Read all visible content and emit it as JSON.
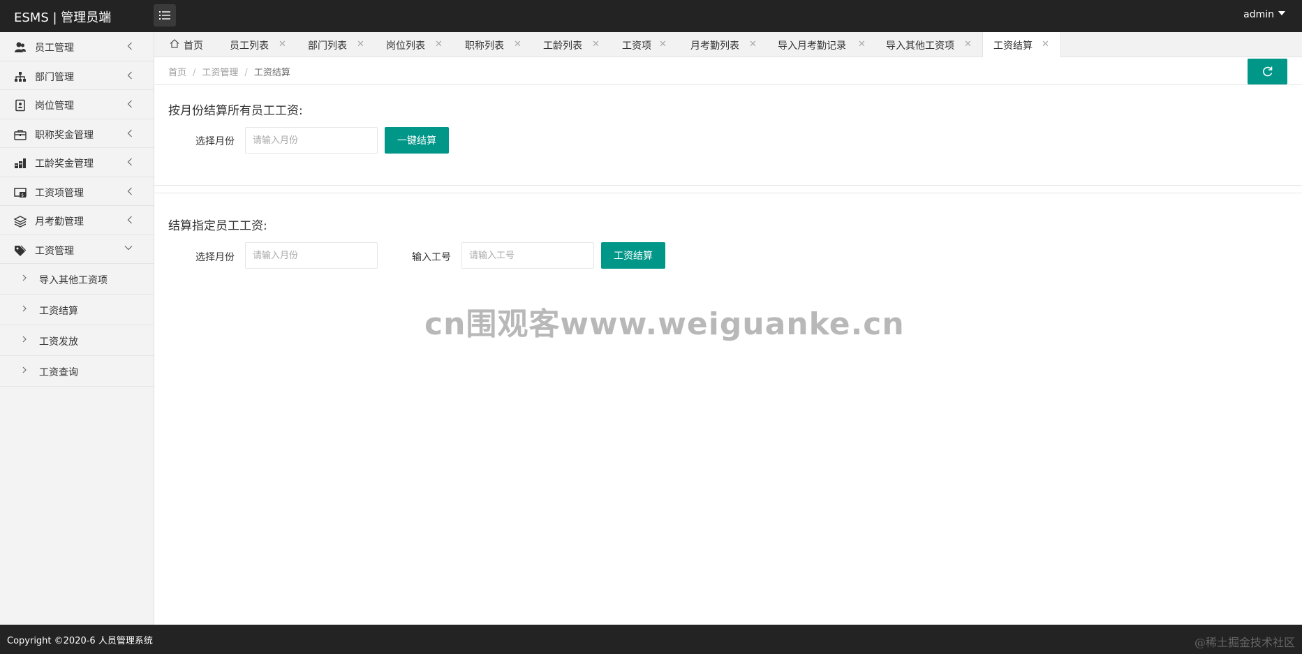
{
  "header": {
    "brand": "ESMS | 管理员端",
    "user": "admin"
  },
  "sidebar": {
    "items": [
      {
        "label": "员工管理",
        "icon": "users-icon"
      },
      {
        "label": "部门管理",
        "icon": "org-chart-icon"
      },
      {
        "label": "岗位管理",
        "icon": "badge-icon"
      },
      {
        "label": "职称奖金管理",
        "icon": "briefcase-icon"
      },
      {
        "label": "工龄奖金管理",
        "icon": "bars-icon"
      },
      {
        "label": "工资项管理",
        "icon": "money-card-icon"
      },
      {
        "label": "月考勤管理",
        "icon": "layers-icon"
      },
      {
        "label": "工资管理",
        "icon": "tag-icon"
      }
    ],
    "sub_items": [
      {
        "label": "导入其他工资项"
      },
      {
        "label": "工资结算"
      },
      {
        "label": "工资发放"
      },
      {
        "label": "工资查询"
      }
    ]
  },
  "tabs": [
    {
      "label": "首页"
    },
    {
      "label": "员工列表"
    },
    {
      "label": "部门列表"
    },
    {
      "label": "岗位列表"
    },
    {
      "label": "职称列表"
    },
    {
      "label": "工龄列表"
    },
    {
      "label": "工资项"
    },
    {
      "label": "月考勤列表"
    },
    {
      "label": "导入月考勤记录"
    },
    {
      "label": "导入其他工资项"
    },
    {
      "label": "工资结算"
    }
  ],
  "tab_close": "✕",
  "breadcrumb": {
    "items": [
      "首页",
      "工资管理",
      "工资结算"
    ],
    "separator": "/"
  },
  "section1": {
    "title": "按月份结算所有员工工资:",
    "month_label": "选择月份",
    "month_placeholder": "请输入月份",
    "button": "一键结算"
  },
  "section2": {
    "title": "结算指定员工工资:",
    "month_label": "选择月份",
    "month_placeholder": "请输入月份",
    "id_label": "输入工号",
    "id_placeholder": "请输入工号",
    "button": "工资结算"
  },
  "watermark": "cn围观客www.weiguanke.cn",
  "footer": {
    "copyright": "Copyright ©2020-6 人员管理系统",
    "juejin": "@稀土掘金技术社区"
  },
  "colors": {
    "accent": "#009688",
    "header_bg": "#232323"
  }
}
